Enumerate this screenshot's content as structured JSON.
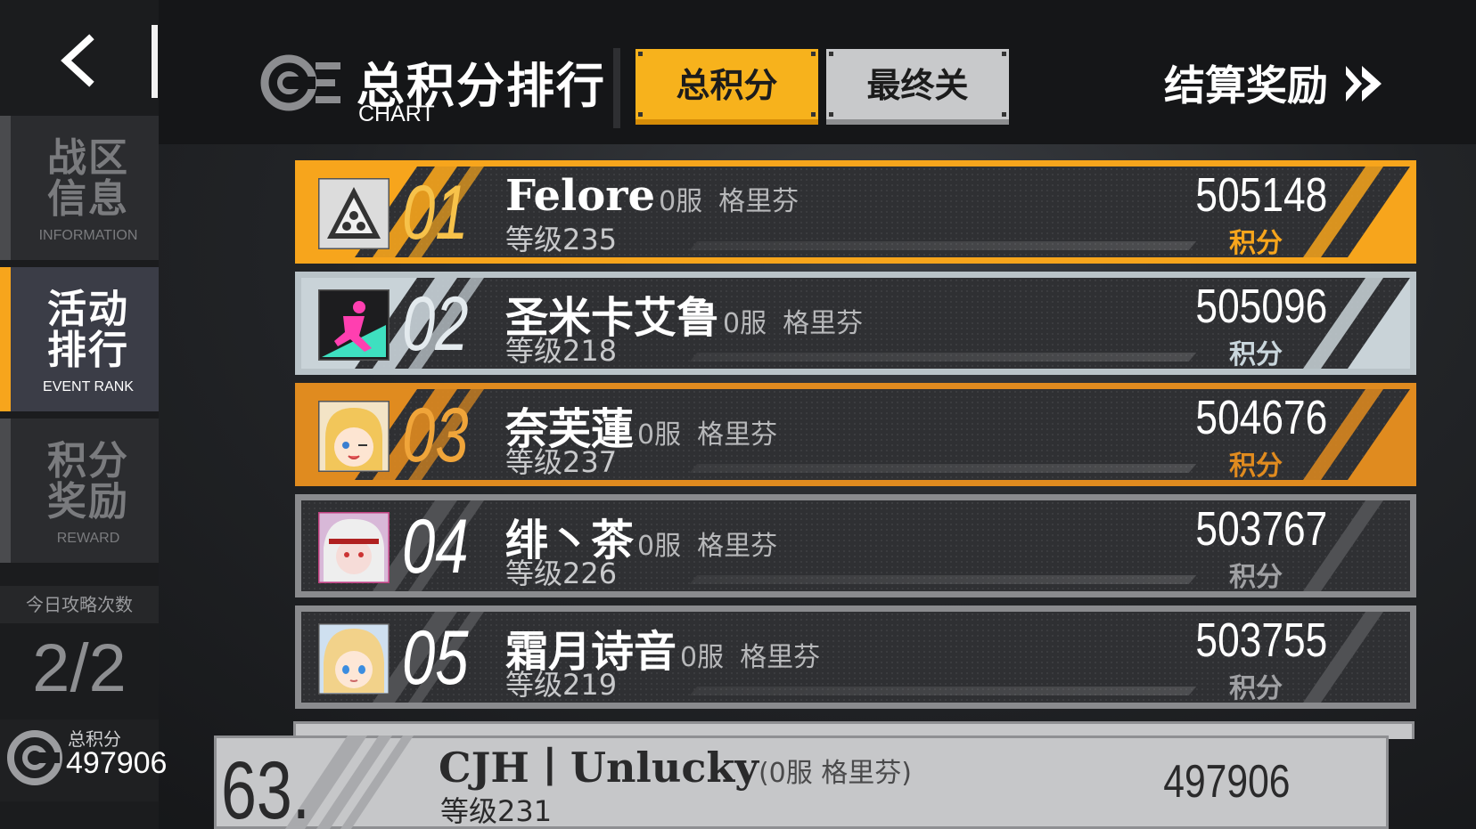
{
  "header": {
    "title": "总积分排行",
    "subtitle": "CHART",
    "tabs": [
      {
        "label": "总积分",
        "active": true
      },
      {
        "label": "最终关",
        "active": false
      }
    ],
    "settle_label": "结算奖励"
  },
  "sidebar": {
    "items": [
      {
        "cn_line1": "战区",
        "cn_line2": "信息",
        "en": "INFORMATION",
        "active": false
      },
      {
        "cn_line1": "活动",
        "cn_line2": "排行",
        "en": "EVENT RANK",
        "active": true
      },
      {
        "cn_line1": "积分",
        "cn_line2": "奖励",
        "en": "REWARD",
        "active": false
      }
    ],
    "attempts_label": "今日攻略次数",
    "attempts_value": "2/2",
    "total_label": "总积分",
    "total_value": "497906"
  },
  "rankings": [
    {
      "rank": "01",
      "name": "Felore",
      "server": "0服",
      "faction": "格里芬",
      "level": "等级235",
      "score": "505148",
      "score_label": "积分",
      "tier": "gold"
    },
    {
      "rank": "02",
      "name": "圣米卡艾鲁",
      "server": "0服",
      "faction": "格里芬",
      "level": "等级218",
      "score": "505096",
      "score_label": "积分",
      "tier": "silver"
    },
    {
      "rank": "03",
      "name": "奈芙蓮",
      "server": "0服",
      "faction": "格里芬",
      "level": "等级237",
      "score": "504676",
      "score_label": "积分",
      "tier": "bronze"
    },
    {
      "rank": "04",
      "name": "绯丶茶",
      "server": "0服",
      "faction": "格里芬",
      "level": "等级226",
      "score": "503767",
      "score_label": "积分",
      "tier": "normal"
    },
    {
      "rank": "05",
      "name": "霜月诗音",
      "server": "0服",
      "faction": "格里芬",
      "level": "等级219",
      "score": "503755",
      "score_label": "积分",
      "tier": "normal"
    }
  ],
  "my_rank": {
    "rank": "63.",
    "name": "CJH丨Unlucky",
    "server_faction": "(0服  格里芬)",
    "level": "等级231",
    "score": "497906"
  },
  "colors": {
    "gold": "#f7a51c",
    "silver": "#b9c3c8",
    "bronze": "#e08b1f",
    "normal": "#8a8b8e",
    "accent": "#f7b21c"
  }
}
